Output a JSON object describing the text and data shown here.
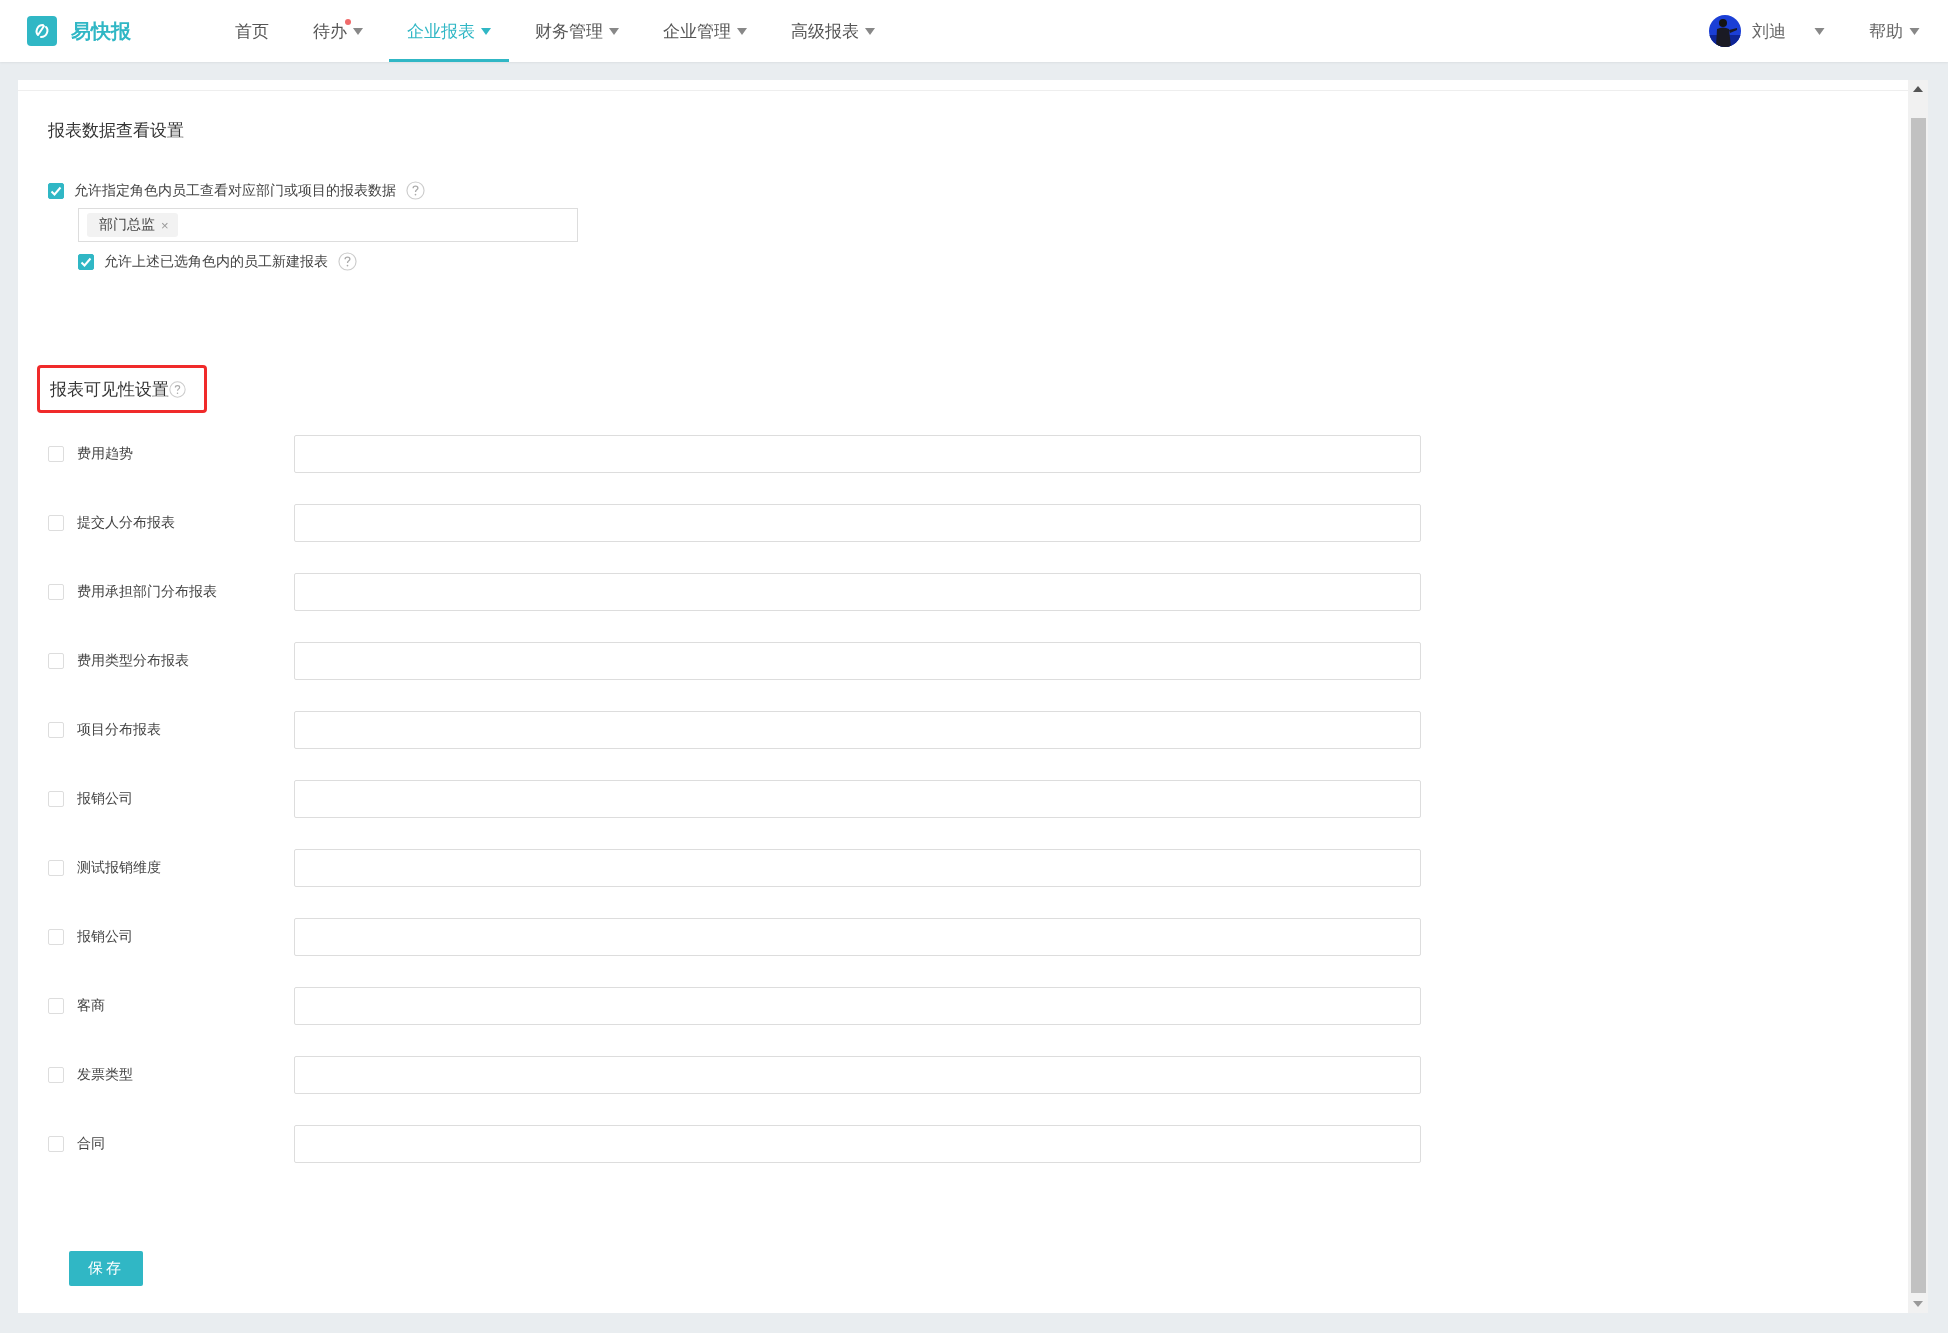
{
  "brand": {
    "name": "易快报"
  },
  "nav": [
    {
      "label": "首页",
      "selected": false,
      "dropdown": false,
      "notification": false
    },
    {
      "label": "待办",
      "selected": false,
      "dropdown": true,
      "notification": true
    },
    {
      "label": "企业报表",
      "selected": true,
      "dropdown": true,
      "notification": false
    },
    {
      "label": "财务管理",
      "selected": false,
      "dropdown": true,
      "notification": false
    },
    {
      "label": "企业管理",
      "selected": false,
      "dropdown": true,
      "notification": false
    },
    {
      "label": "高级报表",
      "selected": false,
      "dropdown": true,
      "notification": false
    }
  ],
  "user": {
    "name": "刘迪"
  },
  "help": {
    "label": "帮助"
  },
  "data_section": {
    "title": "报表数据查看设置",
    "allow_view": {
      "label": "允许指定角色内员工查看对应部门或项目的报表数据",
      "checked": true
    },
    "roles": [
      {
        "label": "部门总监",
        "remove": "×"
      }
    ],
    "allow_create": {
      "label": "允许上述已选角色内的员工新建报表",
      "checked": true
    }
  },
  "visibility_section": {
    "title": "报表可见性设置",
    "highlighted": true,
    "rows": [
      {
        "label": "费用趋势",
        "checked": false
      },
      {
        "label": "提交人分布报表",
        "checked": false
      },
      {
        "label": "费用承担部门分布报表",
        "checked": false
      },
      {
        "label": "费用类型分布报表",
        "checked": false
      },
      {
        "label": "项目分布报表",
        "checked": false
      },
      {
        "label": "报销公司",
        "checked": false
      },
      {
        "label": "测试报销维度",
        "checked": false
      },
      {
        "label": "报销公司",
        "checked": false
      },
      {
        "label": "客商",
        "checked": false
      },
      {
        "label": "发票类型",
        "checked": false
      },
      {
        "label": "合同",
        "checked": false
      }
    ]
  },
  "save_button": {
    "label": "保存"
  }
}
